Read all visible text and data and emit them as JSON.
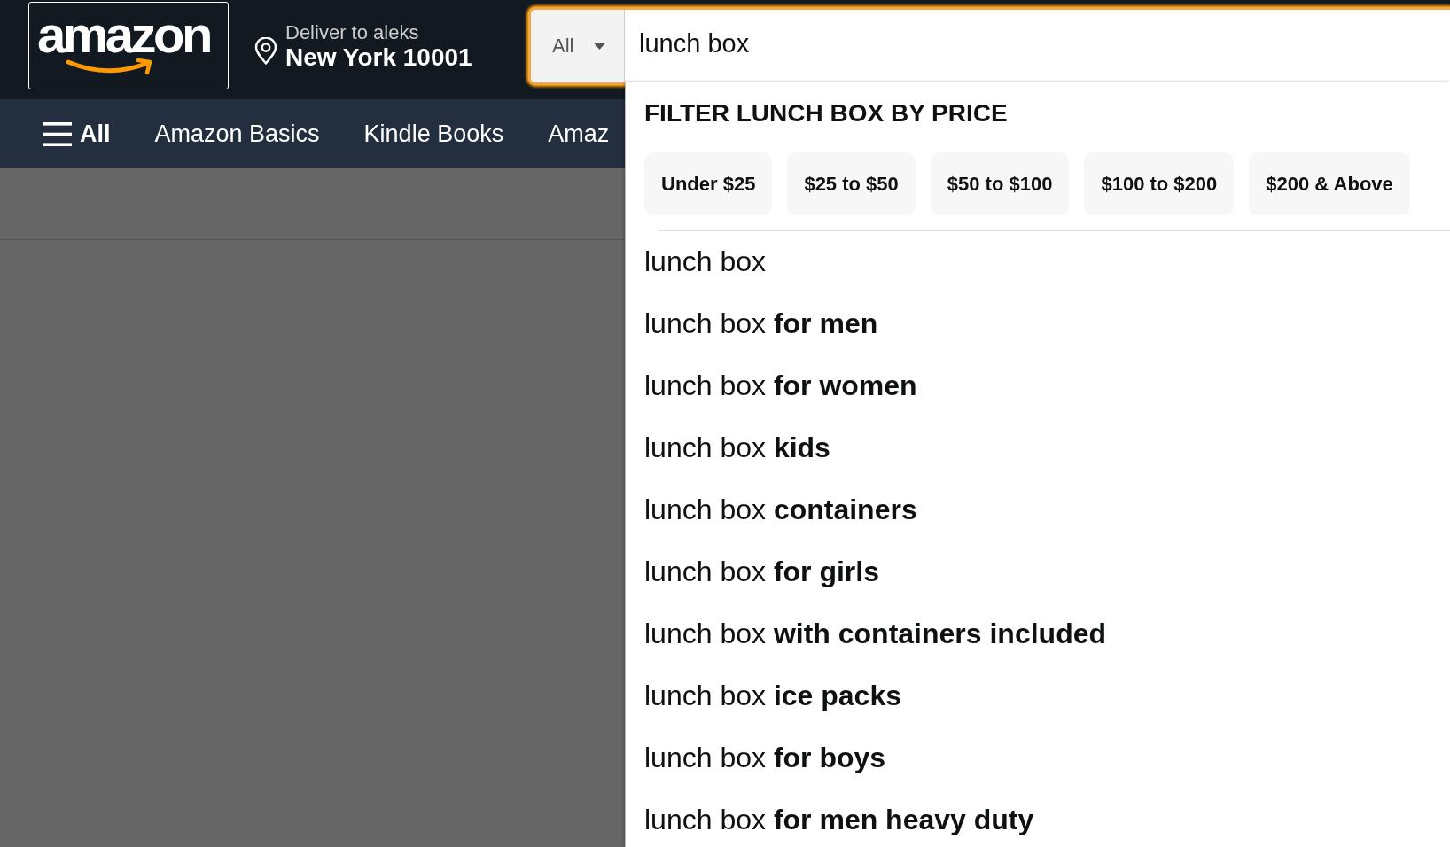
{
  "header": {
    "logo": "amazon",
    "deliver_to": "Deliver to aleks",
    "location": "New York 10001"
  },
  "search": {
    "category": "All",
    "value": "lunch box",
    "focused": true
  },
  "nav": {
    "menu_label": "All",
    "links": [
      "Amazon Basics",
      "Kindle Books",
      "Amaz"
    ]
  },
  "suggestions_dropdown": {
    "heading": "FILTER LUNCH BOX BY PRICE",
    "price_filters": [
      "Under $25",
      "$25 to $50",
      "$50 to $100",
      "$100 to $200",
      "$200 & Above"
    ],
    "suggestions": [
      "lunch box",
      "lunch box **for men**",
      "lunch box **for women**",
      "lunch box **kids**",
      "lunch box **containers**",
      "lunch box **for girls**",
      "lunch box **with containers included**",
      "lunch box **ice packs**",
      "lunch box **for boys**",
      "lunch box **for men heavy duty**"
    ]
  }
}
